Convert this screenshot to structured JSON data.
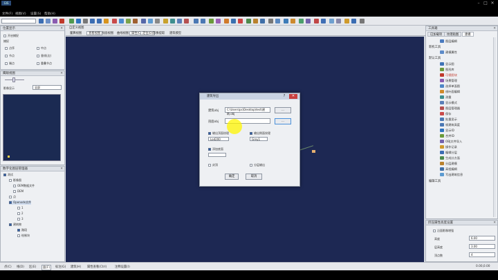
{
  "titlebar": {
    "logo": "GIS",
    "min": "–",
    "max": "□",
    "close": "✕"
  },
  "menu": [
    "文件(F)",
    "视图(V)",
    "设置(S)",
    "帮助(H)"
  ],
  "toolbar": {
    "combo_value": ""
  },
  "layer_panel": {
    "title": "位置显示",
    "items": [
      "开启捕捉",
      "捕捉",
      "点序",
      "中点",
      "节点",
      "垂线(边)",
      "端点",
      "重叠节点"
    ]
  },
  "overview": {
    "title": "鹰眼视图",
    "label": "影像显示",
    "select_value": "全部"
  },
  "tree": {
    "title": "数字化图层管理器",
    "nodes": [
      "测试",
      "影像图",
      "OEM数据文件",
      "DEM",
      "点",
      "Openode文件",
      "1",
      "2",
      "3",
      "建筑物",
      "路段",
      "绘制块"
    ]
  },
  "main_tabs": [
    "自定义视图",
    "量算视图",
    "查看视图",
    "剖面视图",
    "曲线视图",
    "属性(C)",
    "定位(D)",
    "影像提取",
    "建筑模型"
  ],
  "selected_tab_index": 2,
  "right_panel": {
    "title": "工具箱",
    "tabs": [
      "已加载项",
      "纹理贴图",
      "建模"
    ],
    "selected_tab": 2,
    "group1": "新机工具",
    "group2": "默认工具",
    "group3": "编辑工具",
    "tools": [
      "图层编辑",
      "建模属性",
      "显示图",
      "图形库",
      "可视图块",
      "场景管理",
      "选择单面图",
      "线叶面编辑",
      "测量",
      "显示模式",
      "图层管理器",
      "保存",
      "批量显示",
      "帧建筑高度",
      "显示ID",
      "合并ID",
      "OBJ文件导入",
      "操作记录",
      "编辑分层",
      "生成分方面",
      "分层建模",
      "高程编辑",
      "写出建筑信息"
    ],
    "highlighted_tool": 4
  },
  "properties_panel": {
    "title": "挤压属性高度设置",
    "checkbox_label": "沿面影像增强",
    "fields": [
      {
        "label": "高度",
        "value": "6.00"
      },
      {
        "label": "层高度",
        "value": "3.00"
      },
      {
        "label": "顶点数",
        "value": "4"
      }
    ]
  },
  "statusbar": [
    "点(C)",
    "线(D)",
    "区(E)",
    "面(F)",
    "标注(G)",
    "建筑(H)",
    "属性查看(Ctrl)",
    "注释设置(I)"
  ],
  "statusbar_selected": 3,
  "statusbar_right": "0.00,0.00",
  "dialog": {
    "title": "建筑导出",
    "help": "?",
    "close": "✕",
    "path_label": "建筑obj",
    "path_value": "C:\\Users\\pc\\Desktop\\test\\建筑.obj",
    "browse_label": "...",
    "output_label": "剖面obj",
    "output_value": "",
    "output_btn": "...",
    "cb1_label": "输出顶面纹理",
    "cb1_select": "Lod200",
    "cb2_label": "输出侧面纹理",
    "cb2_select": "Grey1",
    "cb3_label": "添加底面",
    "cb4_label": "封顶",
    "cb5_label": "分层输出",
    "ok": "确定",
    "cancel": "取消"
  }
}
